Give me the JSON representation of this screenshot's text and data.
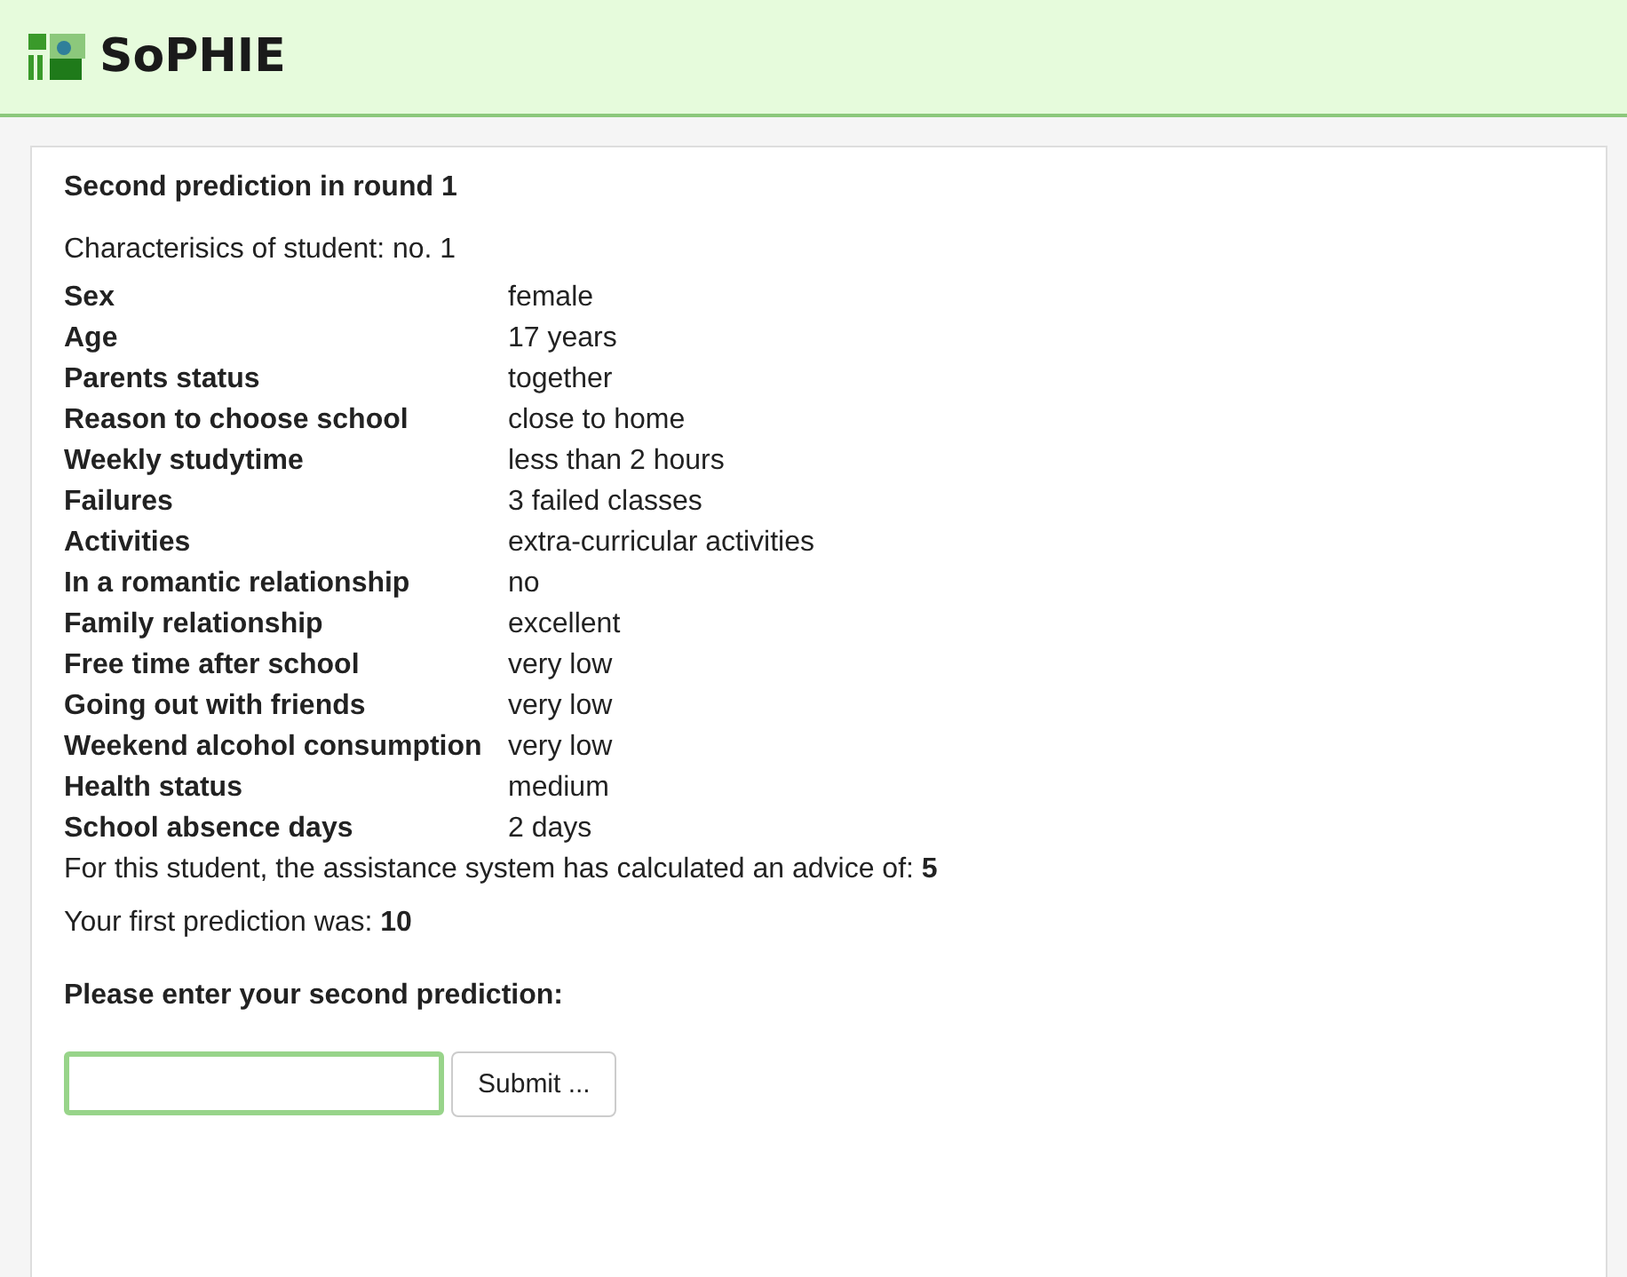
{
  "header": {
    "title": "SoPHIE"
  },
  "panel": {
    "heading": "Second prediction in round 1",
    "subtitle": "Characterisics of student: no. 1",
    "attributes": [
      {
        "label": "Sex",
        "value": "female"
      },
      {
        "label": "Age",
        "value": "17 years"
      },
      {
        "label": "Parents status",
        "value": "together"
      },
      {
        "label": "Reason to choose school",
        "value": "close to home"
      },
      {
        "label": "Weekly studytime",
        "value": "less than 2 hours"
      },
      {
        "label": "Failures",
        "value": "3 failed classes"
      },
      {
        "label": "Activities",
        "value": "extra-curricular activities"
      },
      {
        "label": "In a romantic relationship",
        "value": "no"
      },
      {
        "label": "Family relationship",
        "value": "excellent"
      },
      {
        "label": "Free time after school",
        "value": "very low"
      },
      {
        "label": "Going out with friends",
        "value": "very low"
      },
      {
        "label": "Weekend alcohol consumption",
        "value": "very low"
      },
      {
        "label": "Health status",
        "value": "medium"
      },
      {
        "label": "School absence days",
        "value": "2 days"
      }
    ],
    "advice": "For this student, the assistance system has calculated an advice of: **5**",
    "first_prediction": "Your first prediction was: **10**",
    "prompt": "Please enter your second prediction:",
    "submit_button": "Submit ..."
  }
}
